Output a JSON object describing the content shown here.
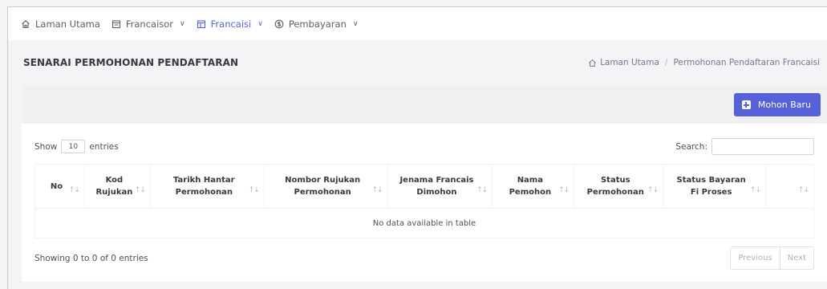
{
  "nav": {
    "items": [
      {
        "label": "Laman Utama",
        "icon": "home-icon",
        "has_chevron": false
      },
      {
        "label": "Francaisor",
        "icon": "calendar-icon",
        "has_chevron": true
      },
      {
        "label": "Francaisi",
        "icon": "layout-icon",
        "has_chevron": true,
        "active": true
      },
      {
        "label": "Pembayaran",
        "icon": "dollar-circle-icon",
        "has_chevron": true
      }
    ]
  },
  "page": {
    "title": "SENARAI PERMOHONAN PENDAFTARAN",
    "breadcrumb": {
      "home": "Laman Utama",
      "separator": "/",
      "current": "Permohonan Pendaftaran Francaisi"
    }
  },
  "actions": {
    "new_button": "Mohon Baru"
  },
  "table": {
    "show_label": "Show",
    "entries_value": "10",
    "entries_label": "entries",
    "search_label": "Search:",
    "search_value": "",
    "columns": [
      {
        "line1": "No",
        "line2": ""
      },
      {
        "line1": "Kod",
        "line2": "Rujukan"
      },
      {
        "line1": "Tarikh Hantar",
        "line2": "Permohonan"
      },
      {
        "line1": "Nombor Rujukan",
        "line2": "Permohonan"
      },
      {
        "line1": "Jenama Francais",
        "line2": "Dimohon"
      },
      {
        "line1": "Nama",
        "line2": "Pemohon"
      },
      {
        "line1": "Status",
        "line2": "Permohonan"
      },
      {
        "line1": "Status Bayaran",
        "line2": "Fi Proses"
      },
      {
        "line1": "",
        "line2": ""
      }
    ],
    "empty_message": "No data available in table",
    "info": "Showing 0 to 0 of 0 entries",
    "prev_label": "Previous",
    "next_label": "Next"
  },
  "colors": {
    "accent": "#5660d8",
    "background": "#f4f4f6",
    "card": "#ffffff"
  }
}
